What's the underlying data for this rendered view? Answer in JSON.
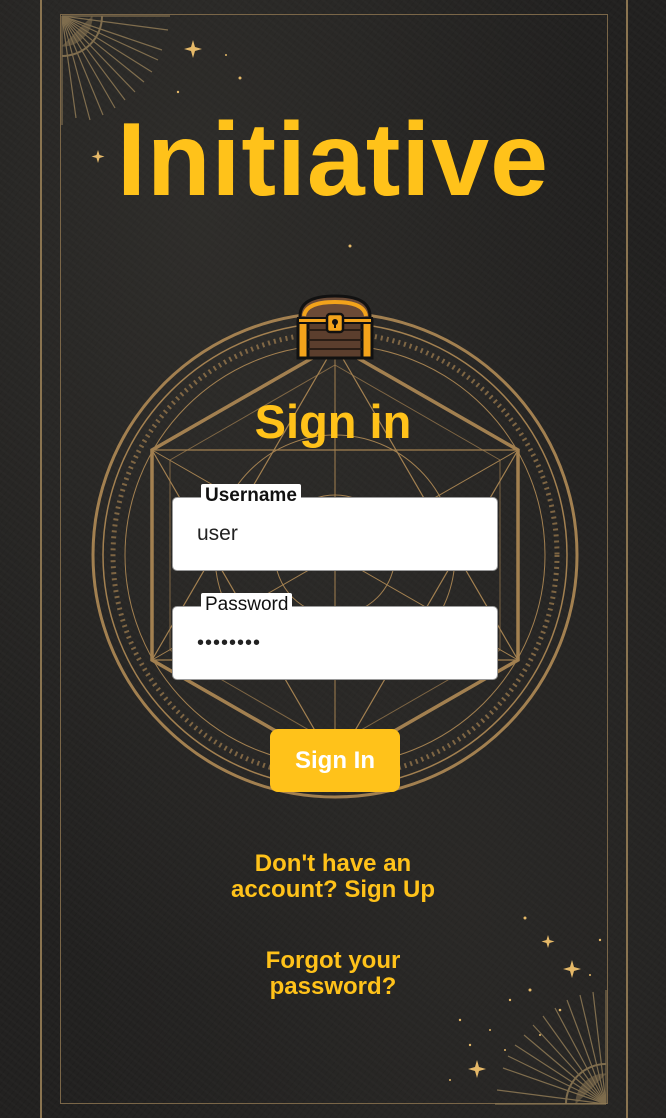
{
  "app": {
    "title": "Initiative"
  },
  "form": {
    "heading": "Sign in",
    "username": {
      "label": "Username",
      "value": "user"
    },
    "password": {
      "label": "Password",
      "value": "••••••••"
    },
    "submit_label": "Sign In"
  },
  "links": {
    "signup_line1": "Don't have an",
    "signup_line2": "account? Sign Up",
    "forgot_line1": "Forgot your",
    "forgot_line2": "password?"
  },
  "colors": {
    "accent": "#ffc21a",
    "background": "#222120",
    "frame": "#8a7450",
    "sigil": "#b08a55"
  },
  "icons": [
    "treasure-chest-icon",
    "magic-circle-sigil",
    "sunburst-ornament",
    "star-sparkle"
  ]
}
